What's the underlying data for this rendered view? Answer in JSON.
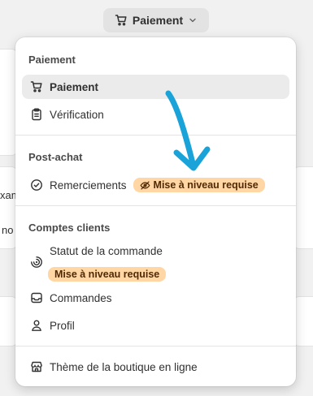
{
  "trigger": {
    "label": "Paiement",
    "icon": "cart-icon"
  },
  "background": {
    "left_text_1": "xam",
    "left_text_2": "no"
  },
  "menu": {
    "sections": [
      {
        "title": "Paiement",
        "items": [
          {
            "label": "Paiement",
            "icon": "cart-icon",
            "active": true
          },
          {
            "label": "Vérification",
            "icon": "clipboard-icon"
          }
        ]
      },
      {
        "title": "Post-achat",
        "items": [
          {
            "label": "Remerciements",
            "icon": "check-circle-icon",
            "badge": "Mise à niveau requise",
            "badge_icon": "eye-off-icon"
          }
        ]
      },
      {
        "title": "Comptes clients",
        "items": [
          {
            "label": "Statut de la commande",
            "icon": "order-status-icon",
            "badge": "Mise à niveau requise"
          },
          {
            "label": "Commandes",
            "icon": "inbox-icon"
          },
          {
            "label": "Profil",
            "icon": "person-icon"
          }
        ]
      }
    ],
    "footer_item": {
      "label": "Thème de la boutique en ligne",
      "icon": "store-icon"
    }
  },
  "colors": {
    "badge_bg": "#ffd6a4",
    "badge_text": "#4f2a04",
    "annotation_arrow": "#1aa3d9",
    "active_bg": "#ebebeb"
  }
}
